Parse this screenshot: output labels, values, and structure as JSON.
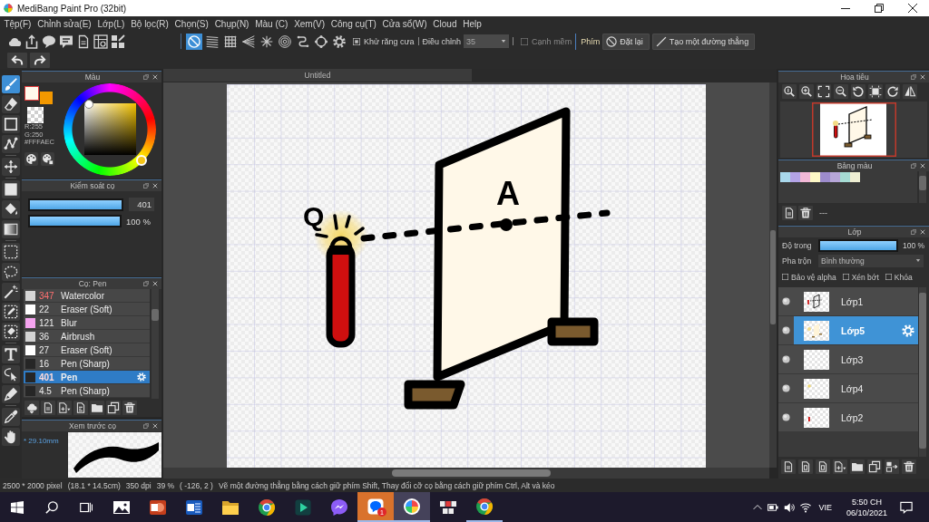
{
  "window": {
    "title": "MediBang Paint Pro (32bit)"
  },
  "menu": [
    "Tệp(F)",
    "Chỉnh sửa(E)",
    "Lớp(L)",
    "Bộ lọc(R)",
    "Chọn(S)",
    "Chụp(N)",
    "Màu (C)",
    "Xem(V)",
    "Công cụ(T)",
    "Cửa sổ(W)",
    "Cloud",
    "Help"
  ],
  "toolbar": {
    "snaps": [
      {
        "selected": true
      },
      {
        "selected": false
      },
      {
        "selected": false
      },
      {
        "selected": false
      },
      {
        "selected": false
      },
      {
        "selected": false
      },
      {
        "selected": false
      },
      {
        "selected": false
      }
    ],
    "antialias": {
      "label": "Khử răng cưa",
      "checked": true
    },
    "adjust": {
      "label": "Điều chỉnh",
      "value": "35"
    },
    "soft_edge": {
      "label": "Cạnh mềm",
      "checked": false,
      "disabled": true
    },
    "keys_label": "Phím",
    "buttons": [
      "Đặt lại",
      "Tạo một đường thẳng"
    ]
  },
  "tools": [
    {
      "selected": true
    },
    {
      "selected": false
    },
    {
      "selected": false
    },
    {
      "selected": false
    },
    {
      "selected": false
    },
    {
      "selected": false
    },
    {
      "selected": false
    },
    {
      "selected": false
    },
    {
      "selected": false
    },
    {
      "selected": false
    },
    {
      "selected": false
    },
    {
      "selected": false
    },
    {
      "selected": false
    },
    {
      "selected": false
    },
    {
      "selected": false
    },
    {
      "selected": false
    },
    {
      "selected": false
    },
    {
      "selected": false
    }
  ],
  "color_panel": {
    "title": "Màu",
    "swatches": [
      {
        "kind": "back",
        "color": "#f39800"
      },
      {
        "kind": "front",
        "color": "#fffaec"
      }
    ],
    "readout": [
      "R:255",
      "G:250",
      "#FFFAEC"
    ]
  },
  "brush_control": {
    "title": "Kiểm soát cọ",
    "size": {
      "level": 1,
      "value": "401"
    },
    "opacity": {
      "level": 1,
      "value": "100 %"
    }
  },
  "brushes": {
    "title": "Cọ: Pen",
    "items": [
      {
        "size": "347",
        "name": "Watercolor",
        "color": "#d6d6d6",
        "flagged": true,
        "selected": false
      },
      {
        "size": "22",
        "name": "Eraser (Soft)",
        "color": "#ffffff",
        "flagged": false,
        "selected": false
      },
      {
        "size": "121",
        "name": "Blur",
        "color": "#f5a3ef",
        "flagged": false,
        "selected": false
      },
      {
        "size": "36",
        "name": "Airbrush",
        "color": "#d2d2d2",
        "flagged": false,
        "selected": false
      },
      {
        "size": "27",
        "name": "Eraser (Soft)",
        "color": "#ffffff",
        "flagged": false,
        "selected": false
      },
      {
        "size": "16",
        "name": "Pen (Sharp)",
        "color": "#262626",
        "flagged": false,
        "selected": false
      },
      {
        "size": "401",
        "name": "Pen",
        "color": "#262626",
        "flagged": true,
        "selected": true
      },
      {
        "size": "4.5",
        "name": "Pen (Sharp)",
        "color": "#262626",
        "flagged": false,
        "selected": false
      }
    ]
  },
  "brush_preview": {
    "title": "Xem trước cọ",
    "size": "* 29.10mm"
  },
  "canvas": {
    "tab": "Untitled",
    "labels": [
      "Q",
      "A"
    ]
  },
  "navigator": {
    "title": "Hoa tiêu"
  },
  "palette": {
    "title": "Bảng màu",
    "colors": [
      {
        "color": "#a9d8ec"
      },
      {
        "color": "#b3a3e6"
      },
      {
        "color": "#f2b8d6"
      },
      {
        "color": "#fdf8c6"
      },
      {
        "color": "#9d8ccc"
      },
      {
        "color": "#b6a6d8"
      },
      {
        "color": "#a6dcd4"
      },
      {
        "color": "#eeeed2"
      }
    ],
    "name": "---"
  },
  "layers": {
    "title": "Lớp",
    "opacity": {
      "label": "Độ trong",
      "level": 1,
      "value": "100 %"
    },
    "blend": {
      "label": "Pha trộn",
      "value": "Bình thường"
    },
    "options": [
      {
        "label": "Bảo vệ alpha",
        "checked": false
      },
      {
        "label": "Xén bớt",
        "checked": false
      },
      {
        "label": "Khóa",
        "checked": false
      }
    ],
    "items": [
      {
        "name": "Lớp1",
        "visible": true,
        "selected": false
      },
      {
        "name": "Lớp5",
        "visible": true,
        "selected": true
      },
      {
        "name": "Lớp3",
        "visible": true,
        "selected": false
      },
      {
        "name": "Lớp4",
        "visible": true,
        "selected": false
      },
      {
        "name": "Lớp2",
        "visible": true,
        "selected": false
      }
    ]
  },
  "status_bar": [
    "2500 * 2000 pixel",
    "(18.1 * 14.5cm)",
    "350 dpi",
    "39 %",
    "( -126, 2 )",
    "Vẽ một đường thẳng bằng cách giữ phím Shift, Thay đổi cỡ cọ bằng cách giữ phím Ctrl, Alt và kéo"
  ],
  "taskbar": {
    "apps": [
      {
        "kind": "photos",
        "flashing": false,
        "active": false,
        "running": false
      },
      {
        "kind": "slides",
        "flashing": false,
        "active": false,
        "running": false
      },
      {
        "kind": "words",
        "flashing": false,
        "active": false,
        "running": false
      },
      {
        "kind": "folder",
        "flashing": false,
        "active": false,
        "running": false
      },
      {
        "kind": "browser",
        "flashing": false,
        "active": false,
        "running": false
      },
      {
        "kind": "player",
        "flashing": false,
        "active": false,
        "running": false
      },
      {
        "kind": "messenger",
        "flashing": false,
        "active": false,
        "running": false
      },
      {
        "kind": "chat",
        "flashing": true,
        "active": false,
        "running": true,
        "badge": "1"
      },
      {
        "kind": "paint",
        "flashing": false,
        "active": true,
        "running": true
      },
      {
        "kind": "tiles",
        "flashing": false,
        "active": false,
        "running": false
      },
      {
        "kind": "browser",
        "flashing": false,
        "active": false,
        "running": true
      }
    ],
    "tray": {
      "language": "VIE",
      "time": "5:50 CH",
      "date": "06/10/2021"
    }
  }
}
